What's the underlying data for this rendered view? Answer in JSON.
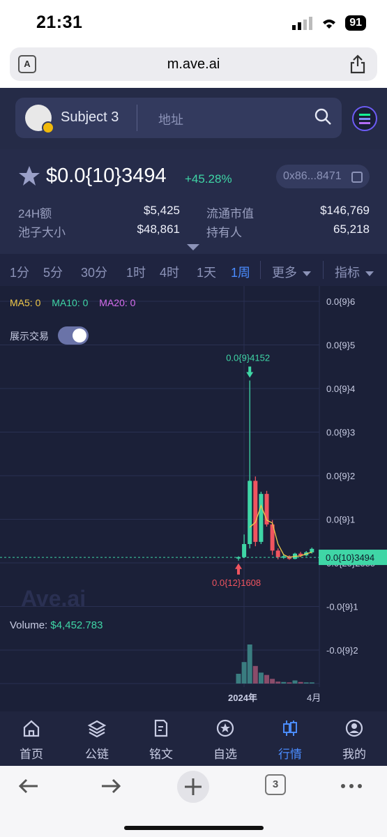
{
  "status_bar": {
    "time": "21:31",
    "battery": "91"
  },
  "browser": {
    "url": "m.ave.ai",
    "tab_count": "3"
  },
  "header": {
    "token_name": "Subject 3",
    "address_placeholder": "地址"
  },
  "token": {
    "price": "$0.0{10}3494",
    "change": "+45.28%",
    "contract": "0x86...8471",
    "stats": {
      "volume_24h_label": "24H额",
      "volume_24h": "$5,425",
      "market_cap_label": "流通市值",
      "market_cap": "$146,769",
      "pool_label": "池子大小",
      "pool": "$48,861",
      "holders_label": "持有人",
      "holders": "65,218"
    }
  },
  "timeframes": [
    "1分",
    "5分",
    "30分",
    "1时",
    "4时",
    "1天",
    "1周"
  ],
  "active_timeframe": "1周",
  "toolbar": {
    "more": "更多",
    "indicators": "指标"
  },
  "chart": {
    "ma5": "MA5: 0",
    "ma10": "MA10: 0",
    "ma20": "MA20: 0",
    "show_trades": "展示交易",
    "watermark": "Ave.ai",
    "volume_label": "Volume:",
    "volume_value": "$4,452.783",
    "high_marker": "0.0{9}4152",
    "low_marker": "0.0{12}1608",
    "current_price_tag": "0.0{10}3494",
    "y_ticks": [
      "0.0{9}6",
      "0.0{9}5",
      "0.0{9}4",
      "0.0{9}3",
      "0.0{9}2",
      "0.0{9}1",
      "0.0{25}2585",
      "-0.0{9}1",
      "-0.0{9}2"
    ],
    "x_ticks": [
      "2024年",
      "4月"
    ],
    "colors": {
      "up": "#3fd6a6",
      "down": "#f0545f",
      "ma5": "#f0c94a",
      "ma10": "#3fd6a6"
    }
  },
  "chart_data": {
    "type": "candlestick",
    "candles": [
      {
        "o": 0.08,
        "h": 0.12,
        "l": 0.02,
        "c": 0.1
      },
      {
        "o": 0.1,
        "h": 0.62,
        "l": 0.08,
        "c": 0.4
      },
      {
        "o": 0.4,
        "h": 4.152,
        "l": 0.3,
        "c": 1.85
      },
      {
        "o": 1.85,
        "h": 1.95,
        "l": 0.35,
        "c": 0.45
      },
      {
        "o": 0.45,
        "h": 1.6,
        "l": 0.4,
        "c": 1.55
      },
      {
        "o": 1.55,
        "h": 1.62,
        "l": 0.8,
        "c": 0.85
      },
      {
        "o": 0.85,
        "h": 0.95,
        "l": 0.15,
        "c": 0.25
      },
      {
        "o": 0.25,
        "h": 0.3,
        "l": 0.05,
        "c": 0.1
      },
      {
        "o": 0.1,
        "h": 0.16,
        "l": 0.06,
        "c": 0.12
      },
      {
        "o": 0.12,
        "h": 0.14,
        "l": 0.04,
        "c": 0.06
      },
      {
        "o": 0.06,
        "h": 0.2,
        "l": 0.05,
        "c": 0.18
      },
      {
        "o": 0.18,
        "h": 0.22,
        "l": 0.1,
        "c": 0.14
      },
      {
        "o": 0.14,
        "h": 0.24,
        "l": 0.12,
        "c": 0.21
      },
      {
        "o": 0.21,
        "h": 0.32,
        "l": 0.18,
        "c": 0.29
      }
    ],
    "volumes": [
      0.25,
      0.55,
      1.0,
      0.45,
      0.28,
      0.22,
      0.12,
      0.05,
      0.04,
      0.03,
      0.08,
      0.04,
      0.03,
      0.03
    ]
  },
  "nav": {
    "home": "首页",
    "chain": "公链",
    "inscription": "铭文",
    "watchlist": "自选",
    "market": "行情",
    "mine": "我的"
  }
}
